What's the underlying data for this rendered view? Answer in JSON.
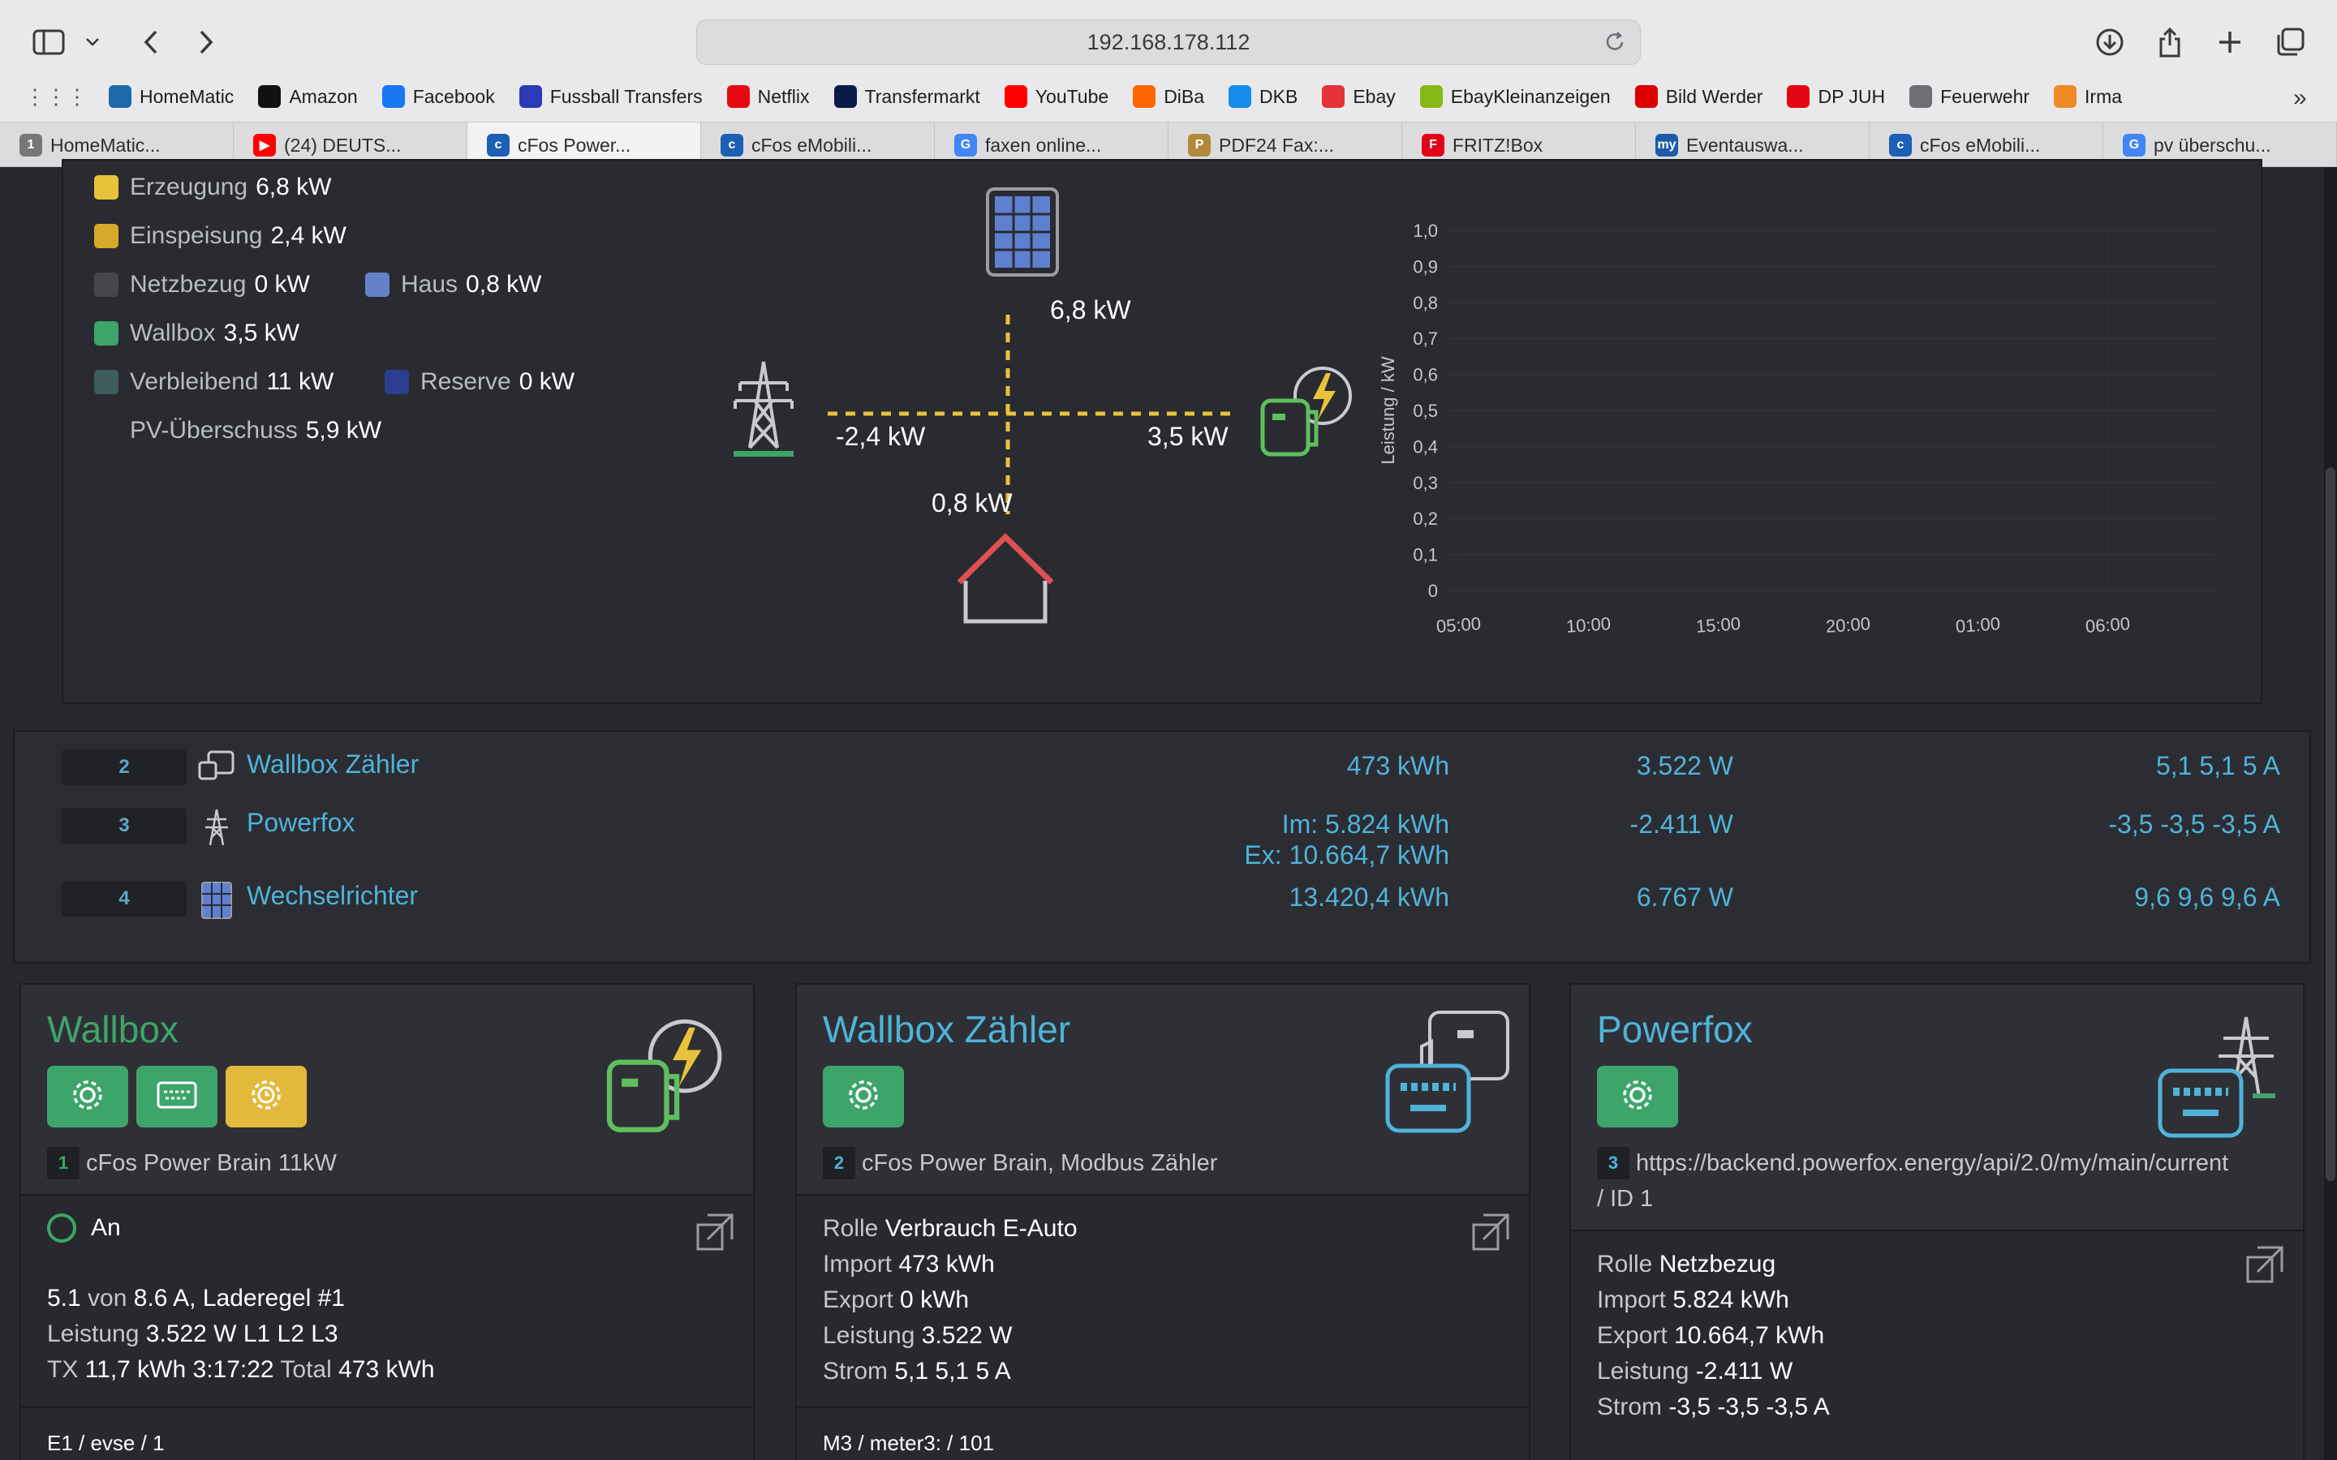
{
  "browser": {
    "url": "192.168.178.112",
    "bookmarks": [
      {
        "label": "HomeMatic",
        "icon": "homematic-icon",
        "color": "#1e6aa8"
      },
      {
        "label": "Amazon",
        "icon": "amazon-icon",
        "color": "#111111"
      },
      {
        "label": "Facebook",
        "icon": "facebook-icon",
        "color": "#1877f2"
      },
      {
        "label": "Fussball Transfers",
        "icon": "transfers-icon",
        "color": "#2a3bb5"
      },
      {
        "label": "Netflix",
        "icon": "netflix-icon",
        "color": "#e50914"
      },
      {
        "label": "Transfermarkt",
        "icon": "transfermarkt-icon",
        "color": "#0a1a4a"
      },
      {
        "label": "YouTube",
        "icon": "youtube-icon",
        "color": "#ff0000"
      },
      {
        "label": "DiBa",
        "icon": "diba-icon",
        "color": "#ff6600"
      },
      {
        "label": "DKB",
        "icon": "dkb-icon",
        "color": "#148dea"
      },
      {
        "label": "Ebay",
        "icon": "ebay-icon",
        "color": "#e53238"
      },
      {
        "label": "EbayKleinanzeigen",
        "icon": "kleinanzeigen-icon",
        "color": "#86b817"
      },
      {
        "label": "Bild Werder",
        "icon": "bild-icon",
        "color": "#dd0000"
      },
      {
        "label": "DP JUH",
        "icon": "juh-icon",
        "color": "#e30613"
      },
      {
        "label": "Feuerwehr",
        "icon": "folder-icon",
        "color": "#6e6e73"
      },
      {
        "label": "Irma",
        "icon": "irma-icon",
        "color": "#f08a24"
      }
    ],
    "tabs": [
      {
        "label": "HomeMatic...",
        "icon": "homematic-icon",
        "color": "#777777",
        "glyph": "1"
      },
      {
        "label": "(24) DEUTS...",
        "icon": "youtube-icon",
        "color": "#ff0000",
        "glyph": "▶"
      },
      {
        "label": "cFos Power...",
        "icon": "cfos-icon",
        "color": "#1c5fb5",
        "glyph": "c"
      },
      {
        "label": "cFos eMobili...",
        "icon": "cfos-icon",
        "color": "#1c5fb5",
        "glyph": "c"
      },
      {
        "label": "faxen online...",
        "icon": "google-icon",
        "color": "#4285f4",
        "glyph": "G"
      },
      {
        "label": "PDF24 Fax:...",
        "icon": "pdf24-icon",
        "color": "#b08a3a",
        "glyph": "P"
      },
      {
        "label": "FRITZ!Box",
        "icon": "fritzbox-icon",
        "color": "#e2001a",
        "glyph": "F"
      },
      {
        "label": "Eventauswa...",
        "icon": "my-icon",
        "color": "#1e5aa8",
        "glyph": "my"
      },
      {
        "label": "cFos eMobili...",
        "icon": "cfos-icon",
        "color": "#1c5fb5",
        "glyph": "c"
      },
      {
        "label": "pv überschu...",
        "icon": "google-icon",
        "color": "#4285f4",
        "glyph": "G"
      }
    ],
    "active_tab": 2
  },
  "legend": [
    {
      "label": "Erzeugung",
      "value": "6,8 kW",
      "color": "#e9c23c"
    },
    {
      "label": "Einspeisung",
      "value": "2,4 kW",
      "color": "#d6a92a"
    },
    {
      "label": "Netzbezug",
      "value": "0 kW",
      "color": "#45474d"
    },
    {
      "label": "Haus",
      "value": "0,8 kW",
      "color": "#6482c9"
    },
    {
      "label": "Wallbox",
      "value": "3,5 kW",
      "color": "#3ea56a"
    },
    {
      "label": "Verbleibend",
      "value": "11 kW",
      "color": "#3f5c5e"
    },
    {
      "label": "Reserve",
      "value": "0 kW",
      "color": "#2c3f8f"
    },
    {
      "label": "PV-Überschuss",
      "value": "5,9 kW",
      "color": ""
    }
  ],
  "flow": {
    "pv": "6,8 kW",
    "grid": "-2,4 kW",
    "wallbox": "3,5 kW",
    "house": "0,8 kW"
  },
  "chart_data": {
    "type": "line",
    "ylabel": "Leistung / kW",
    "xlabel": "",
    "title": "",
    "ylim": [
      0,
      1.0
    ],
    "yticks": [
      "1,0",
      "0,9",
      "0,8",
      "0,7",
      "0,6",
      "0,5",
      "0,4",
      "0,3",
      "0,2",
      "0,1",
      "0"
    ],
    "xticks": [
      "05:00",
      "10:00",
      "15:00",
      "20:00",
      "01:00",
      "06:00"
    ],
    "series": []
  },
  "meters": [
    {
      "id": "2",
      "name": "Wallbox Zähler",
      "icon": "wallbox-meter-icon",
      "energy": "473 kWh",
      "energy2": "",
      "power": "3.522 W",
      "current": "5,1 5,1 5 A"
    },
    {
      "id": "3",
      "name": "Powerfox",
      "icon": "grid-pylon-icon",
      "energy": "Im: 5.824 kWh",
      "energy2": "Ex: 10.664,7 kWh",
      "power": "-2.411 W",
      "current": "-3,5 -3,5 -3,5 A"
    },
    {
      "id": "4",
      "name": "Wechselrichter",
      "icon": "solar-panel-icon",
      "energy": "13.420,4 kWh",
      "energy2": "",
      "power": "6.767 W",
      "current": "9,6 9,6 9,6 A"
    }
  ],
  "cards": {
    "wallbox": {
      "title": "Wallbox",
      "badge": "1",
      "subtitle": "cFos Power Brain 11kW",
      "status": "An",
      "line1_a": "5.1",
      "line1_b": " von ",
      "line1_c": "8.6 A, Laderegel #1",
      "line2_a": "Leistung ",
      "line2_b": "3.522 W L1 L2 L3",
      "line3_a": "TX ",
      "line3_b": "11,7 kWh 3:17:22",
      "line3_c": " Total ",
      "line3_d": "473 kWh",
      "footer": "E1 / evse / 1"
    },
    "wallbox_meter": {
      "title": "Wallbox Zähler",
      "badge": "2",
      "subtitle": "cFos Power Brain, Modbus Zähler",
      "role_label": "Rolle ",
      "role": "Verbrauch E-Auto",
      "import_label": "Import ",
      "import": "473 kWh",
      "export_label": "Export ",
      "export": "0 kWh",
      "power_label": "Leistung ",
      "power": "3.522 W",
      "current_label": "Strom ",
      "current": "5,1 5,1 5 A",
      "footer": "M3 / meter3: / 101"
    },
    "powerfox": {
      "title": "Powerfox",
      "badge": "3",
      "subtitle": "https://backend.powerfox.energy/api/2.0/my/main/current",
      "subtitle2": "/ ID 1",
      "role_label": "Rolle ",
      "role": "Netzbezug",
      "import_label": "Import ",
      "import": "5.824 kWh",
      "export_label": "Export ",
      "export": "10.664,7 kWh",
      "power_label": "Leistung ",
      "power": "-2.411 W",
      "current_label": "Strom ",
      "current": "-3,5 -3,5 -3,5 A"
    }
  },
  "colors": {
    "accent_green": "#3ea56a",
    "accent_blue": "#4fb3d9",
    "accent_yellow": "#e2b93b",
    "flow_line": "#e9c23c",
    "house_roof": "#e05050"
  }
}
